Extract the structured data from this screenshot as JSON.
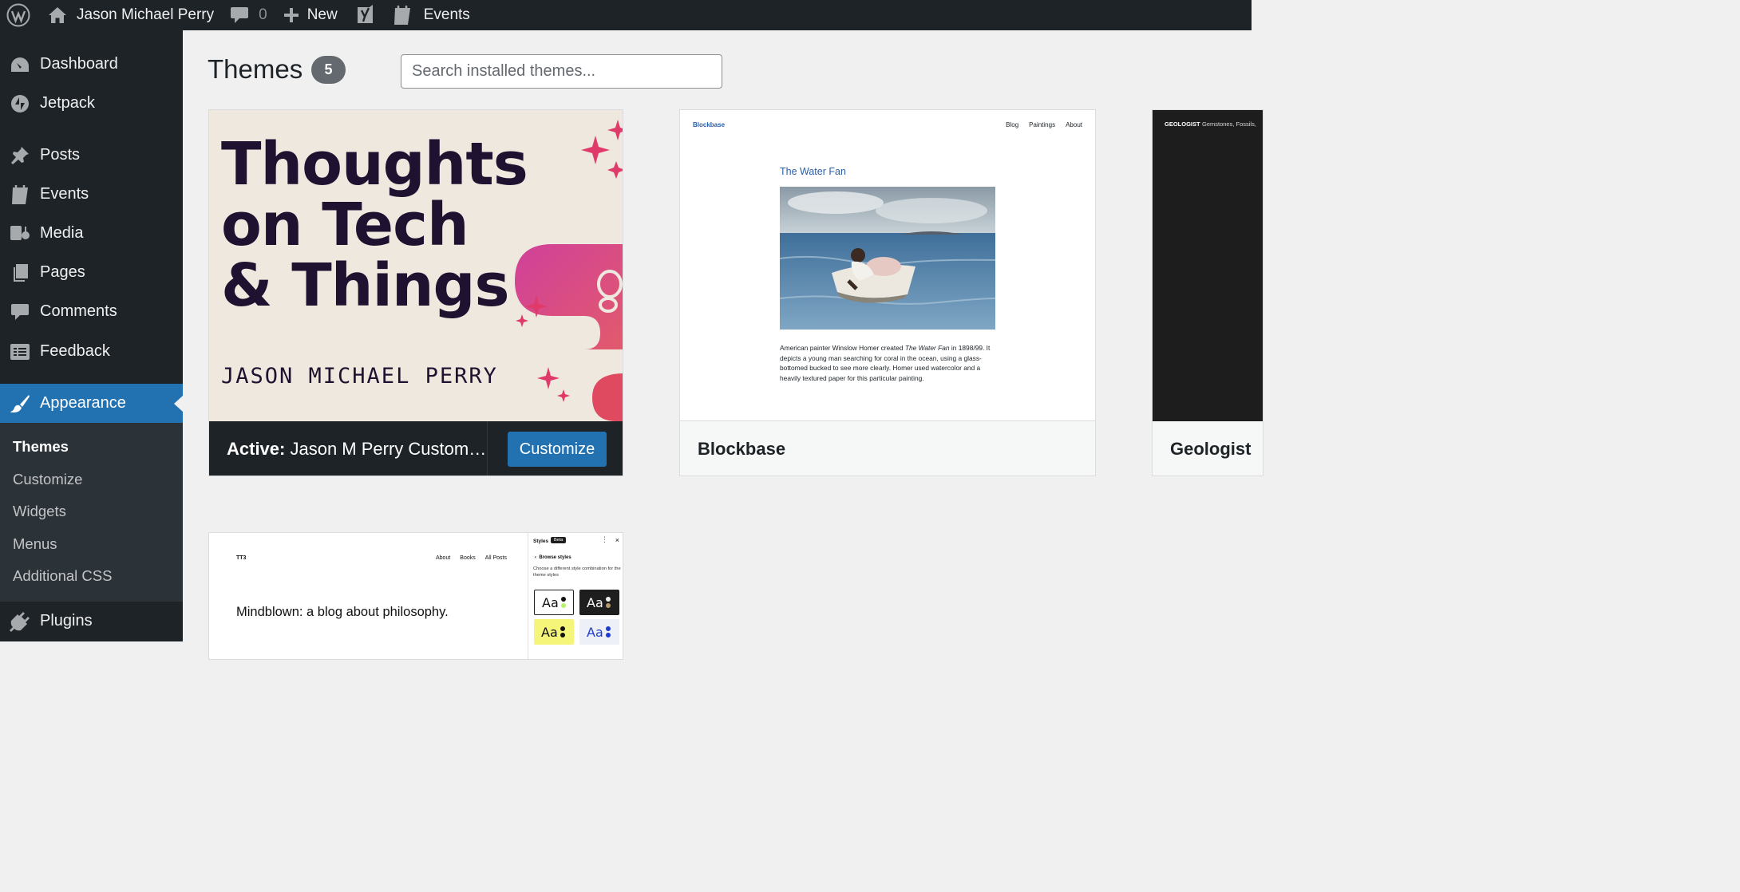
{
  "admin_bar": {
    "site_name": "Jason Michael Perry",
    "comments_count": "0",
    "new_label": "New",
    "events_label": "Events"
  },
  "sidebar": {
    "items": [
      {
        "label": "Dashboard",
        "icon": "dashboard-icon"
      },
      {
        "label": "Jetpack",
        "icon": "jetpack-icon"
      },
      {
        "label": "Posts",
        "icon": "pushpin-icon"
      },
      {
        "label": "Events",
        "icon": "calendar-icon"
      },
      {
        "label": "Media",
        "icon": "media-icon"
      },
      {
        "label": "Pages",
        "icon": "pages-icon"
      },
      {
        "label": "Comments",
        "icon": "comment-icon"
      },
      {
        "label": "Feedback",
        "icon": "feedback-icon"
      },
      {
        "label": "Appearance",
        "icon": "paintbrush-icon",
        "current": true
      },
      {
        "label": "Plugins",
        "icon": "plugin-icon"
      }
    ],
    "submenu": [
      "Themes",
      "Customize",
      "Widgets",
      "Menus",
      "Additional CSS"
    ]
  },
  "main": {
    "title": "Themes",
    "count": "5",
    "search_placeholder": "Search installed themes..."
  },
  "themes": {
    "active": {
      "prefix": "Active:",
      "name": "Jason M Perry Custom Theme",
      "button": "Customize",
      "cover_title_lines": [
        "Thoughts",
        "on Tech",
        "& Things"
      ],
      "cover_author": "JASON MICHAEL PERRY"
    },
    "blockbase": {
      "name": "Blockbase",
      "preview_site": "Blockbase",
      "preview_nav": [
        "Blog",
        "Paintings",
        "About"
      ],
      "post_title": "The Water Fan",
      "excerpt_before": "American painter Winslow Homer created ",
      "excerpt_italic": "The Water Fan",
      "excerpt_after": " in 1898/99. It depicts a young man searching for coral in the ocean, using a glass-bottomed bucked to see more clearly. Homer used watercolor and a heavily textured paper for this particular painting."
    },
    "geologist": {
      "name": "Geologist",
      "preview_site": "GEOLOGIST",
      "preview_nav": "Gemstones, Fossils,"
    },
    "tt3": {
      "preview_site": "TT3",
      "preview_nav": [
        "About",
        "Books",
        "All Posts"
      ],
      "tagline": "Mindblown: a blog about philosophy.",
      "panel_title": "Styles",
      "panel_badge": "Beta",
      "panel_browse": "Browse styles",
      "panel_desc": "Choose a different style combination for the theme styles",
      "swatch_text": "Aa"
    }
  },
  "colors": {
    "admin_dark": "#1d2327",
    "accent": "#2271b1",
    "cover_bg": "#efe8df",
    "cover_pink": "#e04a8a"
  }
}
